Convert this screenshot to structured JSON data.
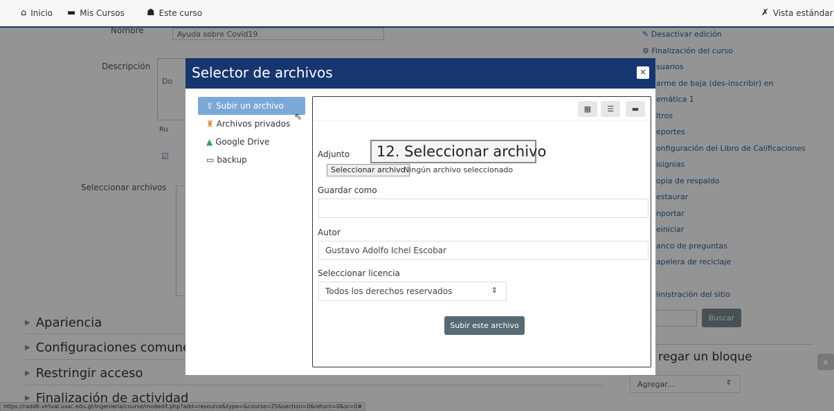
{
  "navbar": {
    "home": "Inicio",
    "courses": "Mis Cursos",
    "this_course": "Este curso",
    "view": "Vista estándar"
  },
  "form": {
    "nombre_label": "Nombre",
    "nombre_value": "Ayuda sobre Covid19",
    "descripcion_label": "Descripción",
    "desc_fragment": "Do",
    "ruta_fragment": "Ru",
    "select_files_label": "Seleccionar archivos"
  },
  "sections": [
    "Apariencia",
    "Configuraciones comunes",
    "Restringir acceso",
    "Finalización de actividad"
  ],
  "admin_menu": [
    "Desactivar edición",
    "Finalización del curso",
    "suarios",
    "arme de baja (des-inscribir) en",
    "emática 1",
    "ltros",
    "eportes",
    "onfiguración del Libro de Calificaciones",
    "isignias",
    "opia de respaldo",
    "estaurar",
    "nportar",
    "einiciar",
    "anco de preguntas",
    "apelera de reciclaje",
    "",
    "iinistración del sitio"
  ],
  "search_button": "Buscar",
  "add_block": {
    "title": "regar un bloque",
    "select_value": "Agregar..."
  },
  "status_url": "https://radd6.virtual.usac.edu.gt/ingenieria/course/modedit.php?add=resource&type=&course=25&section=0&return=0&sr=0#",
  "modal": {
    "title": "Selector de archivos",
    "close": "×",
    "repositories": [
      {
        "label": "Subir un archivo",
        "icon": "upload-icon",
        "glyph": "⇪",
        "active": true
      },
      {
        "label": "Archivos privados",
        "icon": "private-files-icon",
        "glyph": "♜",
        "active": false
      },
      {
        "label": "Google Drive",
        "icon": "google-drive-icon",
        "glyph": "▲",
        "active": false
      },
      {
        "label": "backup",
        "icon": "backup-icon",
        "glyph": "▭",
        "active": false
      }
    ],
    "attachment_label": "Adjunto",
    "choose_file_button": "Seleccionar archivo",
    "no_file_text": "Ningún archivo seleccionado",
    "save_as_label": "Guardar como",
    "save_as_value": "",
    "callout": "12. Seleccionar archivo",
    "author_label": "Autor",
    "author_value": "Gustavo Adolfo Ichel Escobar",
    "license_label": "Seleccionar licencia",
    "license_value": "Todos los derechos reservados",
    "upload_button": "Subir este archivo"
  },
  "colors": {
    "header_blue": "#17366f",
    "active_repo": "#7aa8d9",
    "upload_button": "#566b73"
  }
}
